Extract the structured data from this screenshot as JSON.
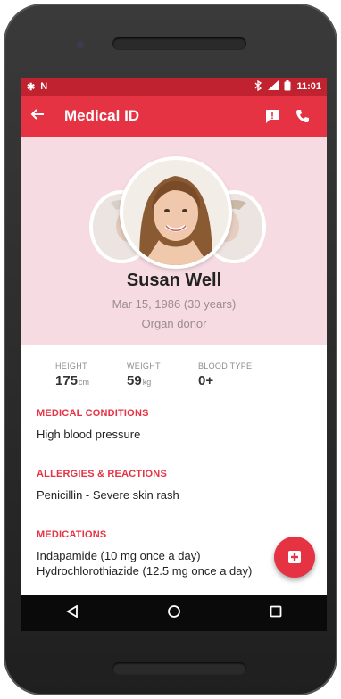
{
  "statusbar": {
    "left_icons": [
      "asterisk-icon",
      "n-notification-icon"
    ],
    "right_icons": [
      "bluetooth-icon",
      "signal-icon",
      "battery-icon"
    ],
    "time": "11:01"
  },
  "appbar": {
    "title": "Medical ID",
    "icons": [
      "back-arrow-icon",
      "message-alert-icon",
      "phone-icon"
    ]
  },
  "profile": {
    "name": "Susan Well",
    "dob": "Mar 15, 1986 (30 years)",
    "donor_status": "Organ donor"
  },
  "stats": {
    "height": {
      "label": "HEIGHT",
      "value": "175",
      "unit": "cm"
    },
    "weight": {
      "label": "WEIGHT",
      "value": "59",
      "unit": "kg"
    },
    "blood": {
      "label": "BLOOD TYPE",
      "value": "0+"
    }
  },
  "sections": {
    "conditions": {
      "title": "MEDICAL CONDITIONS",
      "text": "High blood pressure"
    },
    "allergies": {
      "title": "ALLERGIES & REACTIONS",
      "text": "Penicillin - Severe skin rash"
    },
    "medications": {
      "title": "MEDICATIONS",
      "lines": [
        "Indapamide (10 mg once a day)",
        "Hydrochlorothiazide (12.5 mg once a day)"
      ]
    }
  },
  "navbar": {
    "icons": [
      "back-triangle-icon",
      "home-circle-icon",
      "recents-square-icon"
    ]
  },
  "colors": {
    "accent": "#e53344",
    "statusbar": "#c0222f",
    "profile_bg": "#f6dce2"
  }
}
